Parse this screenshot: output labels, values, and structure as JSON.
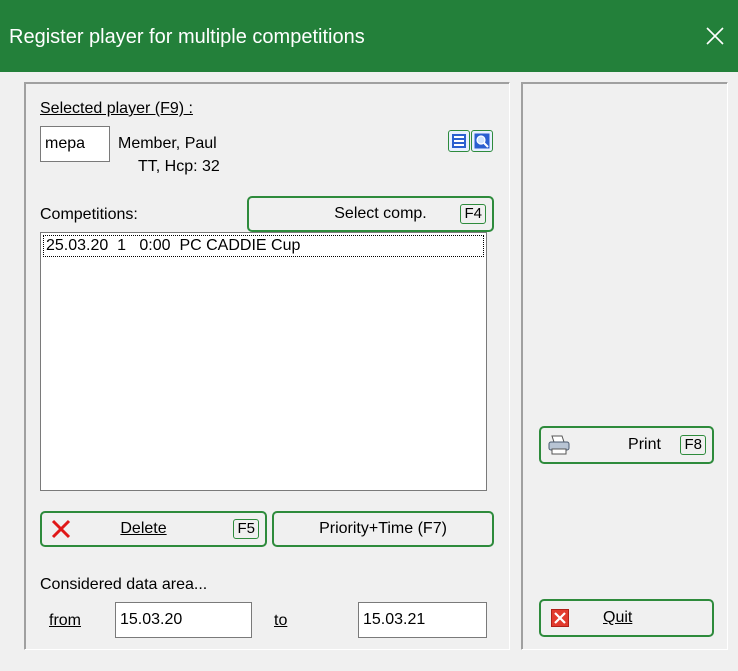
{
  "window": {
    "title": "Register player for multiple competitions"
  },
  "player": {
    "section_label": "Selected player (F9) :",
    "code": "mepa",
    "name": "Member, Paul",
    "details": "TT, Hcp: 32"
  },
  "competitions": {
    "label": "Competitions:",
    "select_button": "Select comp.",
    "select_key": "F4",
    "items": [
      "25.03.20  1   0:00  PC CADDIE Cup"
    ]
  },
  "actions": {
    "delete_label": "Delete",
    "delete_key": "F5",
    "priority_label": "Priority+Time (F7)"
  },
  "data_area": {
    "label": "Considered data area...",
    "from_label": "from",
    "from_value": "15.03.20",
    "to_label": "to",
    "to_value": "15.03.21"
  },
  "side": {
    "print_label": "Print",
    "print_key": "F8",
    "quit_label": "Quit"
  },
  "colors": {
    "titlebar": "#23803a",
    "button_border": "#2e8b3c"
  }
}
